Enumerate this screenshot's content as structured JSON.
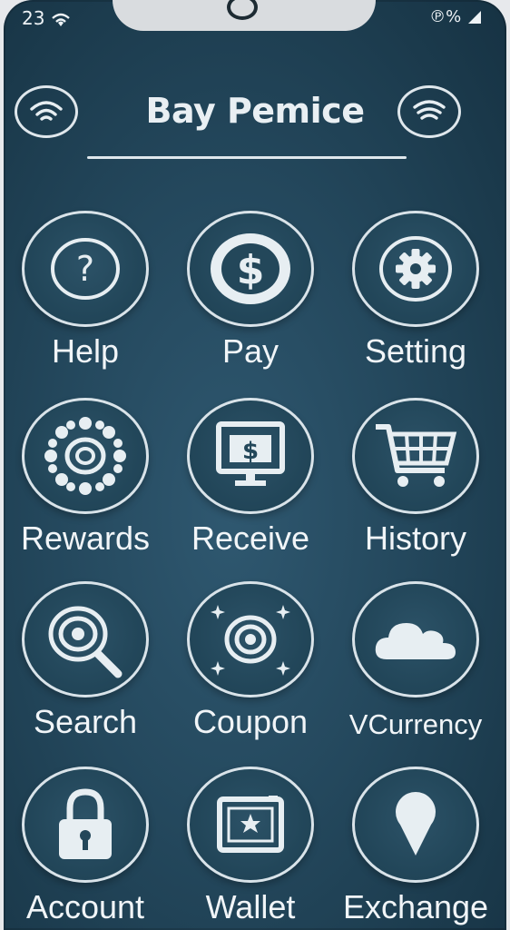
{
  "status": {
    "time": "23",
    "right_text": "℗%"
  },
  "header": {
    "title": "Bay Pemice",
    "left_icon": "wifi-icon",
    "right_icon": "wifi-icon"
  },
  "grid": {
    "items": [
      {
        "label": "Help",
        "icon": "question-icon"
      },
      {
        "label": "Pay",
        "icon": "dollar-icon",
        "glyph": "$"
      },
      {
        "label": "Setting",
        "icon": "gear-icon"
      },
      {
        "label": "Rewards",
        "icon": "rewards-dots-icon"
      },
      {
        "label": "Receive",
        "icon": "monitor-money-icon",
        "glyph": "$"
      },
      {
        "label": "History",
        "icon": "cart-icon"
      },
      {
        "label": "Search",
        "icon": "search-target-icon"
      },
      {
        "label": "Coupon",
        "icon": "target-sparkle-icon"
      },
      {
        "label": "VCurrency",
        "icon": "cloud-icon"
      },
      {
        "label": "Account",
        "icon": "lock-icon"
      },
      {
        "label": "Wallet",
        "icon": "wallet-star-icon"
      },
      {
        "label": "Exchange",
        "icon": "pin-icon"
      }
    ]
  },
  "colors": {
    "background": "#24485d",
    "foreground": "#e9eff3"
  }
}
